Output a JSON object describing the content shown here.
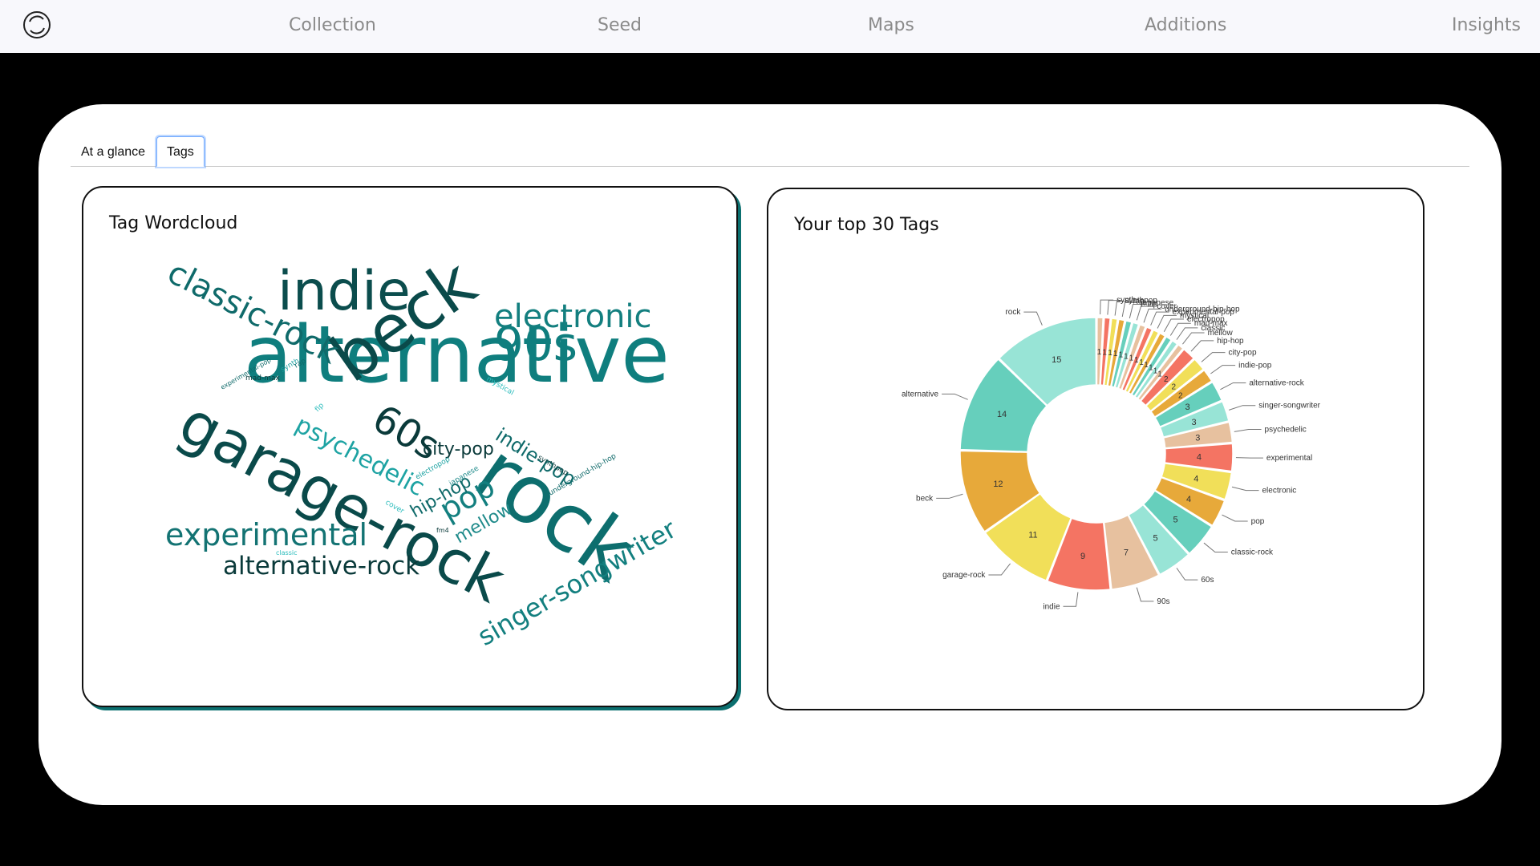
{
  "nav": {
    "logo_icon": "circle-logo-icon",
    "items": [
      {
        "label": "Collection"
      },
      {
        "label": "Seed"
      },
      {
        "label": "Maps"
      },
      {
        "label": "Additions"
      },
      {
        "label": "Insights"
      }
    ]
  },
  "tabs": [
    {
      "label": "At a glance",
      "active": false
    },
    {
      "label": "Tags",
      "active": true
    }
  ],
  "wordcloud": {
    "title": "Tag Wordcloud",
    "words": [
      {
        "text": "alternative",
        "color": "#0f7e7e"
      },
      {
        "text": "garage-rock",
        "color": "#0a4a4a"
      },
      {
        "text": "rock",
        "color": "#0d6e6e"
      },
      {
        "text": "beck",
        "color": "#0a4a4a"
      },
      {
        "text": "indie",
        "color": "#0b4d4d"
      },
      {
        "text": "classic-rock",
        "color": "#0f6a6a"
      },
      {
        "text": "90s",
        "color": "#0f7e7e"
      },
      {
        "text": "electronic",
        "color": "#137f7f"
      },
      {
        "text": "experimental",
        "color": "#137373"
      },
      {
        "text": "alternative-rock",
        "color": "#0a3a3a"
      },
      {
        "text": "singer-songwriter",
        "color": "#137f7f"
      },
      {
        "text": "60s",
        "color": "#0a3a3a"
      },
      {
        "text": "psychedelic",
        "color": "#1ea3a3"
      },
      {
        "text": "city-pop",
        "color": "#0a3a3a"
      },
      {
        "text": "indie-pop",
        "color": "#0f6a6a"
      },
      {
        "text": "pop",
        "color": "#137f7f"
      },
      {
        "text": "hip-hop",
        "color": "#0f6a6a"
      },
      {
        "text": "mellow",
        "color": "#1e8a8a"
      },
      {
        "text": "experimental-pop",
        "color": "#0f6a6a"
      },
      {
        "text": "synth",
        "color": "#1ea3a3"
      },
      {
        "text": "rap",
        "color": "#0f6a6a"
      },
      {
        "text": "mad-max",
        "color": "#0a3a3a"
      },
      {
        "text": "mystical",
        "color": "#2bbcbc"
      },
      {
        "text": "fip",
        "color": "#2bbcbc"
      },
      {
        "text": "electropop",
        "color": "#1ea3a3"
      },
      {
        "text": "japanese",
        "color": "#1e8a8a"
      },
      {
        "text": "synthpop",
        "color": "#0a3a3a"
      },
      {
        "text": "underground-hip-hop",
        "color": "#0f6a6a"
      },
      {
        "text": "cover",
        "color": "#2bbcbc"
      },
      {
        "text": "fm4",
        "color": "#0a3a3a"
      },
      {
        "text": "classic",
        "color": "#2bbcbc"
      }
    ]
  },
  "chart_data": {
    "type": "pie",
    "title": "Your top 30 Tags",
    "donut": true,
    "direction": "counterclockwise",
    "labels": [
      "rock",
      "alternative",
      "beck",
      "garage-rock",
      "indie",
      "90s",
      "60s",
      "classic-rock",
      "pop",
      "electronic",
      "experimental",
      "psychedelic",
      "singer-songwriter",
      "alternative-rock",
      "indie-pop",
      "city-pop",
      "hip-hop",
      "mellow",
      "classic",
      "mad-max",
      "electropop",
      "mystical",
      "experimental-pop",
      "underground-hip-hop",
      "cover",
      "fip",
      "japanese",
      "rap",
      "synthpop",
      "synth"
    ],
    "values": [
      15,
      14,
      12,
      11,
      9,
      7,
      5,
      5,
      4,
      4,
      4,
      3,
      3,
      3,
      2,
      2,
      2,
      1,
      1,
      1,
      1,
      1,
      1,
      1,
      1,
      1,
      1,
      1,
      1,
      1
    ],
    "colors": [
      "#98e4d6",
      "#66cfbc",
      "#e7a93a",
      "#f1df59",
      "#f47463",
      "#e7c19f"
    ]
  }
}
